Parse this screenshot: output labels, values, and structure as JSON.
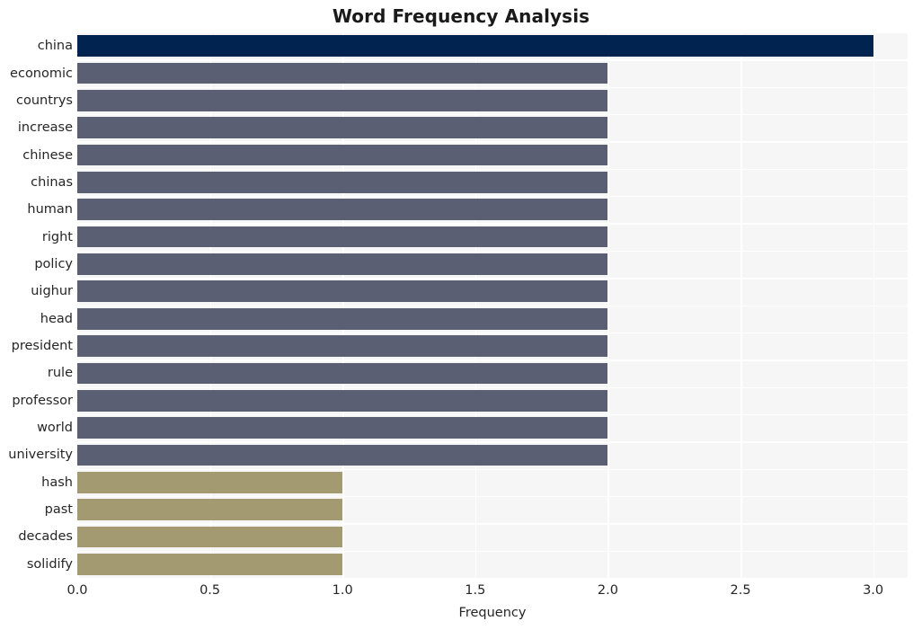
{
  "chart_data": {
    "type": "bar",
    "orientation": "horizontal",
    "title": "Word Frequency Analysis",
    "xlabel": "Frequency",
    "ylabel": "",
    "categories": [
      "china",
      "economic",
      "countrys",
      "increase",
      "chinese",
      "chinas",
      "human",
      "right",
      "policy",
      "uighur",
      "head",
      "president",
      "rule",
      "professor",
      "world",
      "university",
      "hash",
      "past",
      "decades",
      "solidify"
    ],
    "values": [
      3,
      2,
      2,
      2,
      2,
      2,
      2,
      2,
      2,
      2,
      2,
      2,
      2,
      2,
      2,
      2,
      1,
      1,
      1,
      1
    ],
    "bar_colors": [
      "#002350",
      "#5a5f73",
      "#5a5f73",
      "#5a5f73",
      "#5a5f73",
      "#5a5f73",
      "#5a5f73",
      "#5a5f73",
      "#5a5f73",
      "#5a5f73",
      "#5a5f73",
      "#5a5f73",
      "#5a5f73",
      "#5a5f73",
      "#5a5f73",
      "#5a5f73",
      "#a39a72",
      "#a39a72",
      "#a39a72",
      "#a39a72"
    ],
    "xlim": [
      0.0,
      3.13
    ],
    "xticks": [
      0.0,
      0.5,
      1.0,
      1.5,
      2.0,
      2.5,
      3.0
    ],
    "xticklabels": [
      "0.0",
      "0.5",
      "1.0",
      "1.5",
      "2.0",
      "2.5",
      "3.0"
    ],
    "grid": true,
    "grid_color": "#ffffff",
    "legend": false,
    "plot_background": "#f6f6f7",
    "figure_background": "#ffffff",
    "palette": {
      "high": "#002350",
      "mid": "#5a5f73",
      "low": "#a39a72"
    }
  }
}
